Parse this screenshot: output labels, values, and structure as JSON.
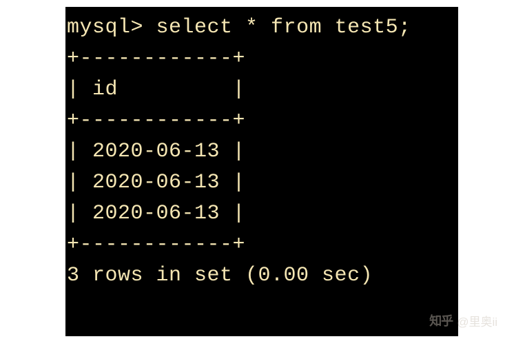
{
  "terminal": {
    "prompt": "mysql> ",
    "query": "select * from test5;",
    "border_top": "+------------+",
    "header_row": "| id         |",
    "border_mid": "+------------+",
    "data_rows": [
      "| 2020-06-13 |",
      "| 2020-06-13 |",
      "| 2020-06-13 |"
    ],
    "border_bot": "+------------+",
    "result_status": "3 rows in set (0.00 sec)"
  },
  "chart_data": {
    "type": "table",
    "query": "select * from test5;",
    "columns": [
      "id"
    ],
    "rows": [
      [
        "2020-06-13"
      ],
      [
        "2020-06-13"
      ],
      [
        "2020-06-13"
      ]
    ],
    "row_count": 3,
    "execution_time_sec": 0.0
  },
  "watermark": {
    "logo": "知乎",
    "author": "@里奥ii"
  }
}
